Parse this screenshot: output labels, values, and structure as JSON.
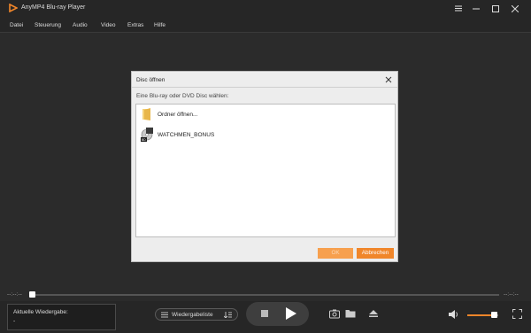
{
  "window": {
    "title": "AnyMP4 Blu-ray Player"
  },
  "menu": [
    "Datei",
    "Steuerung",
    "Audio",
    "Video",
    "Extras",
    "Hilfe"
  ],
  "dialog": {
    "title": "Disc öffnen",
    "subtitle": "Eine Blu-ray oder DVD Disc wählen:",
    "items": [
      {
        "label": "Ordner öffnen...",
        "icon": "folder-icon"
      },
      {
        "label": "WATCHMEN_BONUS",
        "icon": "bluray-disc-icon"
      }
    ],
    "ok_label": "OK",
    "cancel_label": "Abbrechen"
  },
  "playback": {
    "time_elapsed": "--:--:--",
    "time_total": "--:--:--",
    "progress": 0.0,
    "now_playing_label": "Aktuelle Wiedergabe:",
    "now_playing_value": "-",
    "playlist_label": "Wiedergabeliste",
    "volume": 0.8
  },
  "colors": {
    "accent": "#f0862a",
    "background": "#2b2b2b",
    "bar": "#262626"
  }
}
